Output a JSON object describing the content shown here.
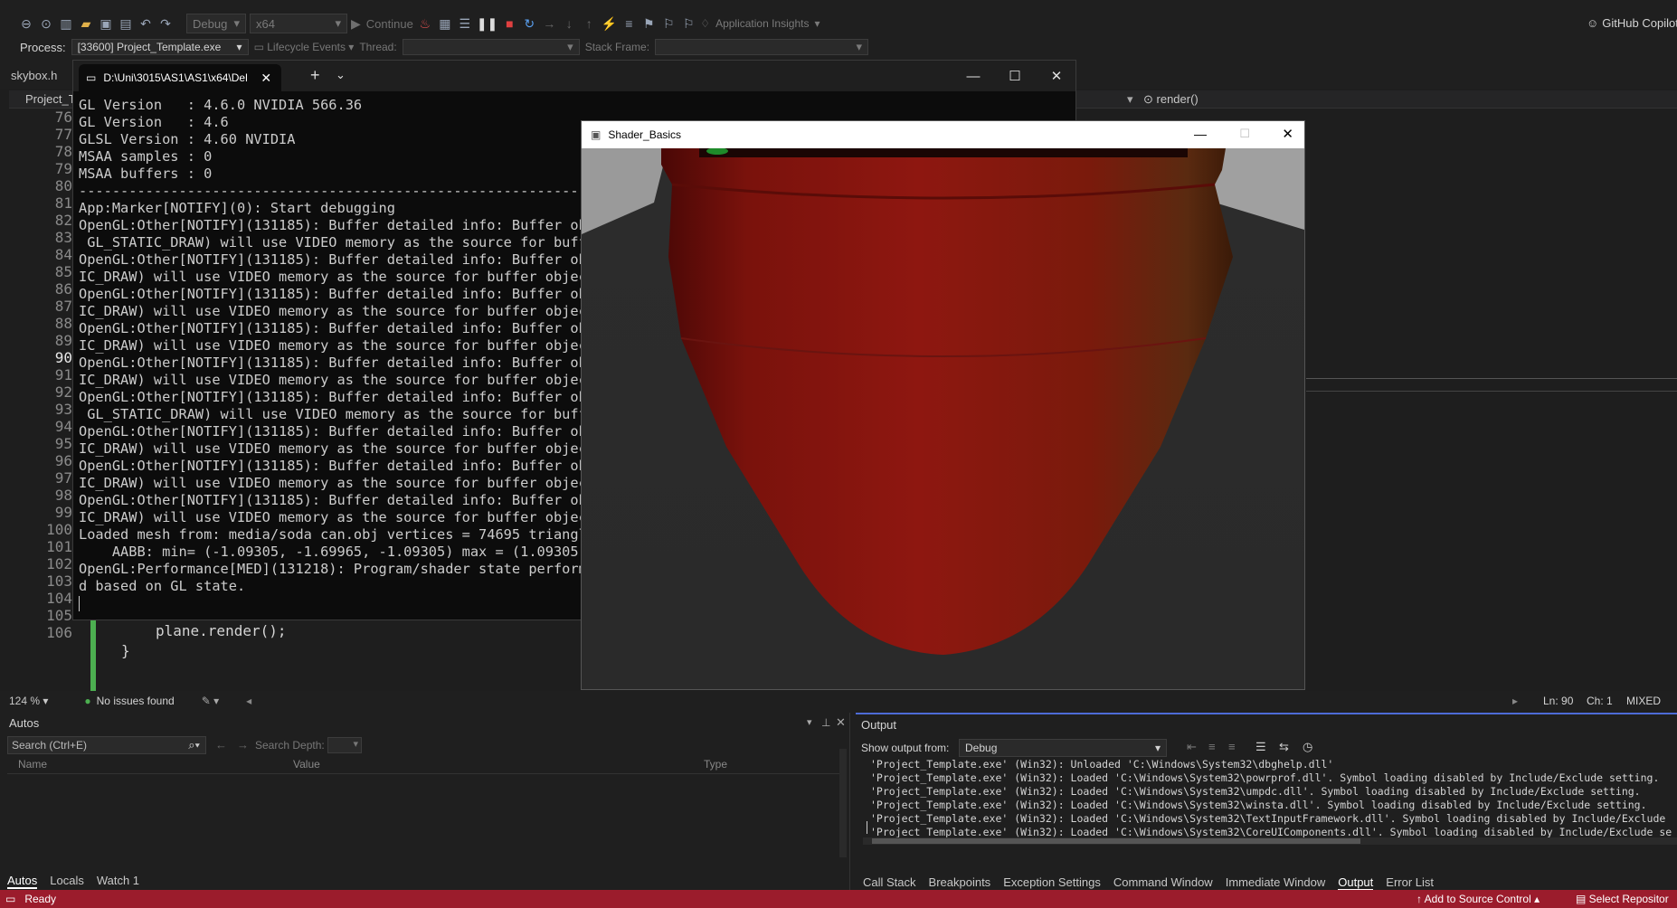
{
  "toolbar": {
    "config": "Debug",
    "platform": "x64",
    "continue_label": "Continue",
    "insights": "Application Insights",
    "copilot": "GitHub Copilot"
  },
  "procbar": {
    "process_label": "Process:",
    "process_value": "[33600] Project_Template.exe",
    "lifecycle": "Lifecycle Events",
    "thread_label": "Thread:",
    "stack_label": "Stack Frame:"
  },
  "editor": {
    "doc_tab": "skybox.h",
    "nav_project": "Project_Te",
    "nav_member": "render()",
    "line_numbers": [
      "76",
      "77",
      "78",
      "79",
      "80",
      "81",
      "82",
      "83",
      "84",
      "85",
      "86",
      "87",
      "88",
      "89",
      "90",
      "91",
      "92",
      "93",
      "94",
      "95",
      "96",
      "97",
      "98",
      "99",
      "100",
      "101",
      "102",
      "103",
      "104",
      "105",
      "106"
    ],
    "code_line_103": "plane.render();",
    "code_line_104": "}"
  },
  "console": {
    "tab_title": "D:\\Uni\\3015\\AS1\\AS1\\x64\\Del",
    "lines": [
      "GL Version   : 4.6.0 NVIDIA 566.36",
      "GL Version   : 4.6",
      "GLSL Version : 4.60 NVIDIA",
      "MSAA samples : 0",
      "MSAA buffers : 0",
      "-----------------------------------------------------------------",
      "App:Marker[NOTIFY](0): Start debugging",
      "OpenGL:Other[NOTIFY](131185): Buffer detailed info: Buffer obj",
      " GL_STATIC_DRAW) will use VIDEO memory as the source for buffe",
      "OpenGL:Other[NOTIFY](131185): Buffer detailed info: Buffer obj",
      "IC_DRAW) will use VIDEO memory as the source for buffer object",
      "OpenGL:Other[NOTIFY](131185): Buffer detailed info: Buffer obj",
      "IC_DRAW) will use VIDEO memory as the source for buffer object",
      "OpenGL:Other[NOTIFY](131185): Buffer detailed info: Buffer obj",
      "IC_DRAW) will use VIDEO memory as the source for buffer object",
      "OpenGL:Other[NOTIFY](131185): Buffer detailed info: Buffer obj",
      "IC_DRAW) will use VIDEO memory as the source for buffer object",
      "OpenGL:Other[NOTIFY](131185): Buffer detailed info: Buffer obj",
      " GL_STATIC_DRAW) will use VIDEO memory as the source for buffe",
      "OpenGL:Other[NOTIFY](131185): Buffer detailed info: Buffer obj",
      "IC_DRAW) will use VIDEO memory as the source for buffer object",
      "OpenGL:Other[NOTIFY](131185): Buffer detailed info: Buffer obj",
      "IC_DRAW) will use VIDEO memory as the source for buffer object",
      "OpenGL:Other[NOTIFY](131185): Buffer detailed info: Buffer obj",
      "IC_DRAW) will use VIDEO memory as the source for buffer object",
      "Loaded mesh from: media/soda can.obj vertices = 74695 triangle",
      "    AABB: min= (-1.09305, -1.69965, -1.09305) max = (1.09305, ",
      "OpenGL:Performance[MED](131218): Program/shader state performa",
      "d based on GL state.",
      ""
    ]
  },
  "shader": {
    "title": "Shader_Basics"
  },
  "editstatus": {
    "zoom": "124 %",
    "issues": "No issues found",
    "line": "Ln: 90",
    "col": "Ch: 1",
    "encoding": "MIXED"
  },
  "autos": {
    "title": "Autos",
    "search_placeholder": "Search (Ctrl+E)",
    "search_depth": "Search Depth:",
    "col_name": "Name",
    "col_value": "Value",
    "col_type": "Type",
    "tabs": [
      "Autos",
      "Locals",
      "Watch 1"
    ]
  },
  "output": {
    "title": "Output",
    "show_from": "Show output from:",
    "source": "Debug",
    "lines": [
      "'Project_Template.exe' (Win32): Unloaded 'C:\\Windows\\System32\\dbghelp.dll'",
      "'Project_Template.exe' (Win32): Loaded 'C:\\Windows\\System32\\powrprof.dll'. Symbol loading disabled by Include/Exclude setting.",
      "'Project_Template.exe' (Win32): Loaded 'C:\\Windows\\System32\\umpdc.dll'. Symbol loading disabled by Include/Exclude setting.",
      "'Project_Template.exe' (Win32): Loaded 'C:\\Windows\\System32\\winsta.dll'. Symbol loading disabled by Include/Exclude setting.",
      "'Project_Template.exe' (Win32): Loaded 'C:\\Windows\\System32\\TextInputFramework.dll'. Symbol loading disabled by Include/Exclude",
      "'Project_Template.exe' (Win32): Loaded 'C:\\Windows\\System32\\CoreUIComponents.dll'. Symbol loading disabled by Include/Exclude se"
    ],
    "tabs": [
      "Call Stack",
      "Breakpoints",
      "Exception Settings",
      "Command Window",
      "Immediate Window",
      "Output",
      "Error List"
    ]
  },
  "statusbar": {
    "ready": "Ready",
    "source_control": "Add to Source Control",
    "repo": "Select Repositor"
  },
  "colors": {
    "status_red": "#9b1c2c",
    "accent_blue": "#4d6bd6",
    "can_red": "#8b1510"
  }
}
